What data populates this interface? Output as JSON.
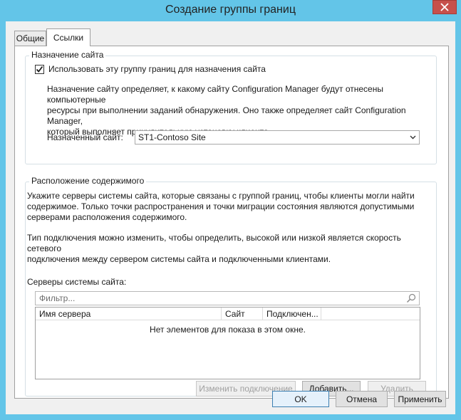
{
  "window": {
    "title": "Создание группы границ"
  },
  "tabs": [
    {
      "label": "Общие"
    },
    {
      "label": "Ссылки"
    }
  ],
  "site_assignment": {
    "group_title": "Назначение сайта",
    "checkbox_label": "Использовать эту группу границ для назначения сайта",
    "checkbox_checked": true,
    "description_lines": [
      "Назначение сайту определяет, к какому сайту Configuration Manager будут отнесены компьютерные",
      "ресурсы при выполнении заданий обнаружения. Оно также определяет сайт Configuration Manager,",
      "который выполняет принудительную установку клиента."
    ],
    "assigned_site_label": "Назначенный сайт:",
    "assigned_site_value": "ST1-Contoso Site"
  },
  "content_location": {
    "group_title": "Расположение содержимого",
    "description_lines": [
      "Укажите серверы системы сайта, которые связаны с группой границ, чтобы клиенты могли найти",
      "содержимое. Только точки распространения и точки миграции состояния являются допустимыми",
      "серверами расположения содержимого."
    ],
    "connection_lines": [
      "Тип подключения можно изменить, чтобы определить, высокой или низкой является скорость сетевого",
      "подключения между сервером системы сайта и подключенными клиентами."
    ],
    "servers_label": "Серверы системы сайта:",
    "filter_placeholder": "Фильтр...",
    "columns": [
      "Имя сервера",
      "Сайт",
      "Подключен..."
    ],
    "empty_message": "Нет элементов для показа в этом окне.",
    "buttons": {
      "change_connection": "Изменить подключение",
      "add": "Добавить...",
      "remove": "Удалить"
    }
  },
  "footer": {
    "ok": "OK",
    "cancel": "Отмена",
    "apply": "Применить"
  }
}
